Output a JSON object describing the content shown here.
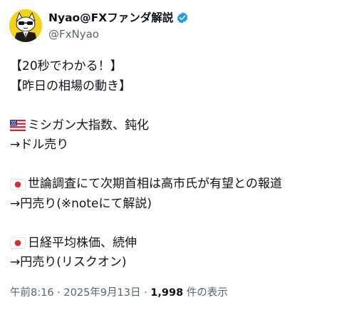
{
  "author": {
    "display_name": "Nyao@FXファンダ解説",
    "handle": "@FxNyao",
    "verified": true,
    "avatar_color": "#f4d21a"
  },
  "tweet": {
    "lines": {
      "l1": "【20秒でわかる！】",
      "l2": "【昨日の相場の動き】",
      "l3": "ミシガン大指数、鈍化",
      "l4": "→ドル売り",
      "l5": "世論調査にて次期首相は高市氏が有望との報道",
      "l6": "→円売り(※noteにて解説)",
      "l7": "日経平均株価、続伸",
      "l8": "→円売り(リスクオン)"
    },
    "flags": {
      "l3": "us-flag-icon",
      "l5": "jp-flag-icon",
      "l7": "jp-flag-icon"
    }
  },
  "meta": {
    "time": "午前8:16",
    "separator": " · ",
    "date": "2025年9月13日",
    "views_count": "1,998",
    "views_label": " 件の表示"
  },
  "colors": {
    "text": "#0f1419",
    "secondary": "#536471",
    "verified_badge": "#1d9bf0"
  }
}
